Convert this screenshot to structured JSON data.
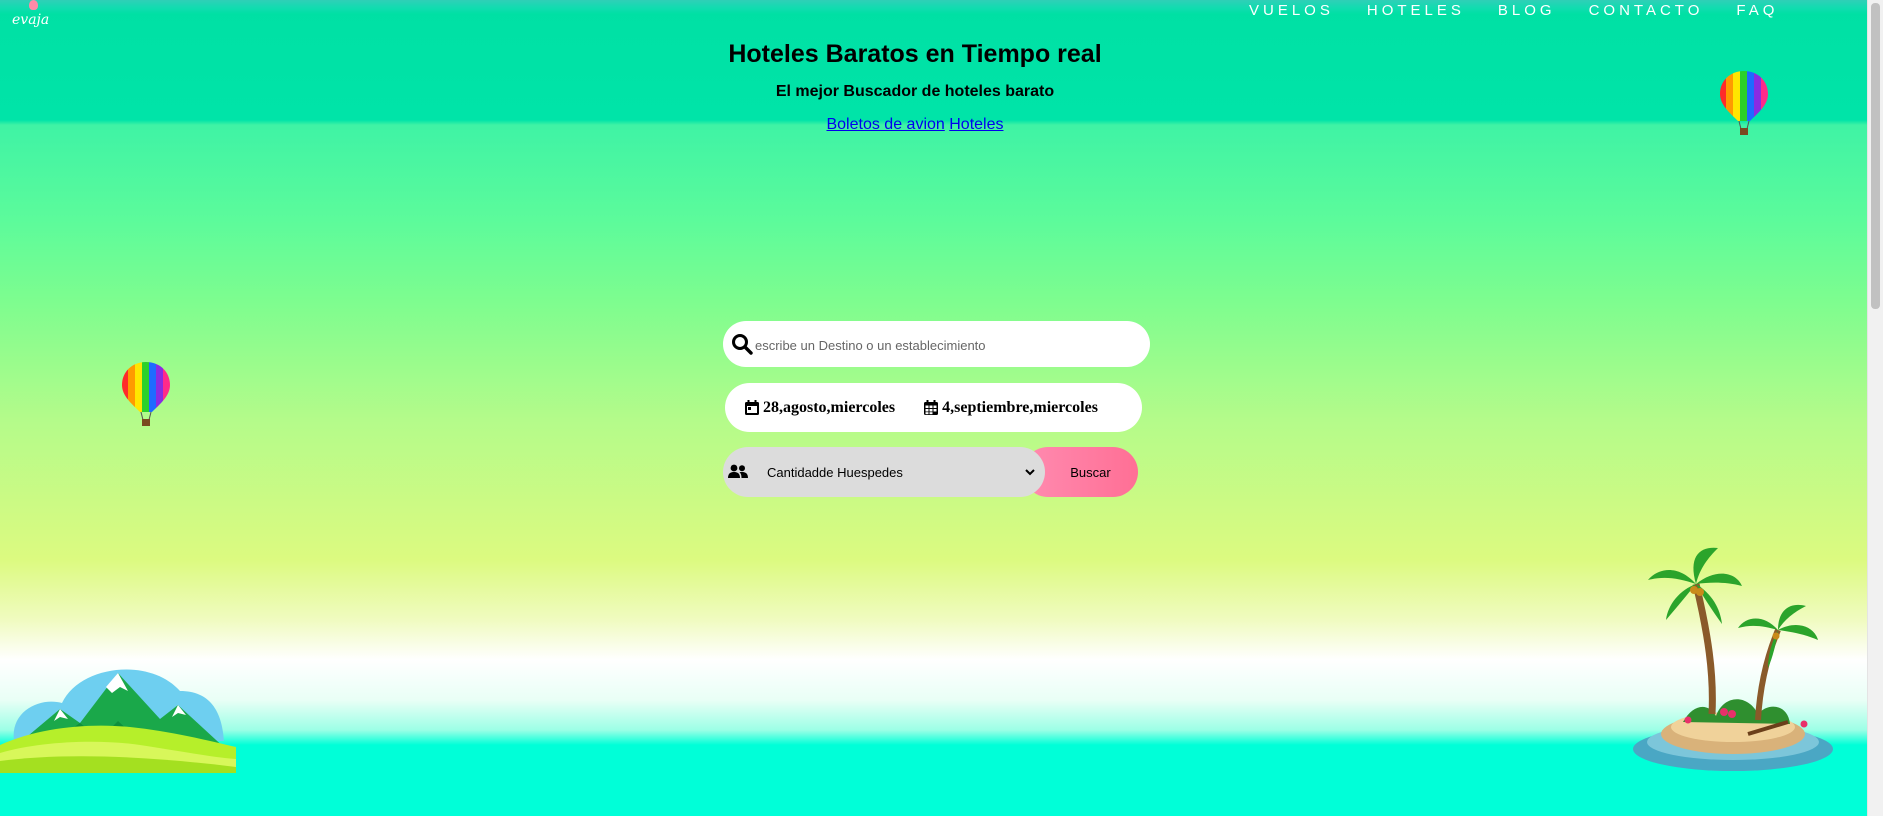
{
  "brand": {
    "logo_text": "evaja"
  },
  "nav": {
    "items": [
      "VUELOS",
      "HOTELES",
      "BLOG",
      "CONTACTO",
      "FAQ"
    ]
  },
  "header": {
    "title": "Hoteles Baratos en Tiempo real",
    "subtitle": "El mejor Buscador de hoteles barato",
    "links": [
      "Boletos de avion",
      "Hoteles"
    ]
  },
  "search": {
    "placeholder": "escribe un Destino o un establecimiento",
    "value": ""
  },
  "dates": {
    "checkin": "28,agosto,miercoles",
    "checkout": "4,septiembre,miercoles"
  },
  "guests": {
    "selected": "Cantidadde Huespedes"
  },
  "buttons": {
    "search_label": "Buscar"
  },
  "colors": {
    "top": "#00e0a4",
    "bottom": "#00ffd8",
    "button": "#ff7fa4",
    "link": "#0000ee"
  },
  "icons": [
    "search-icon",
    "calendar-icon",
    "calendar-alt-icon",
    "users-icon",
    "hot-air-balloon-icon"
  ]
}
